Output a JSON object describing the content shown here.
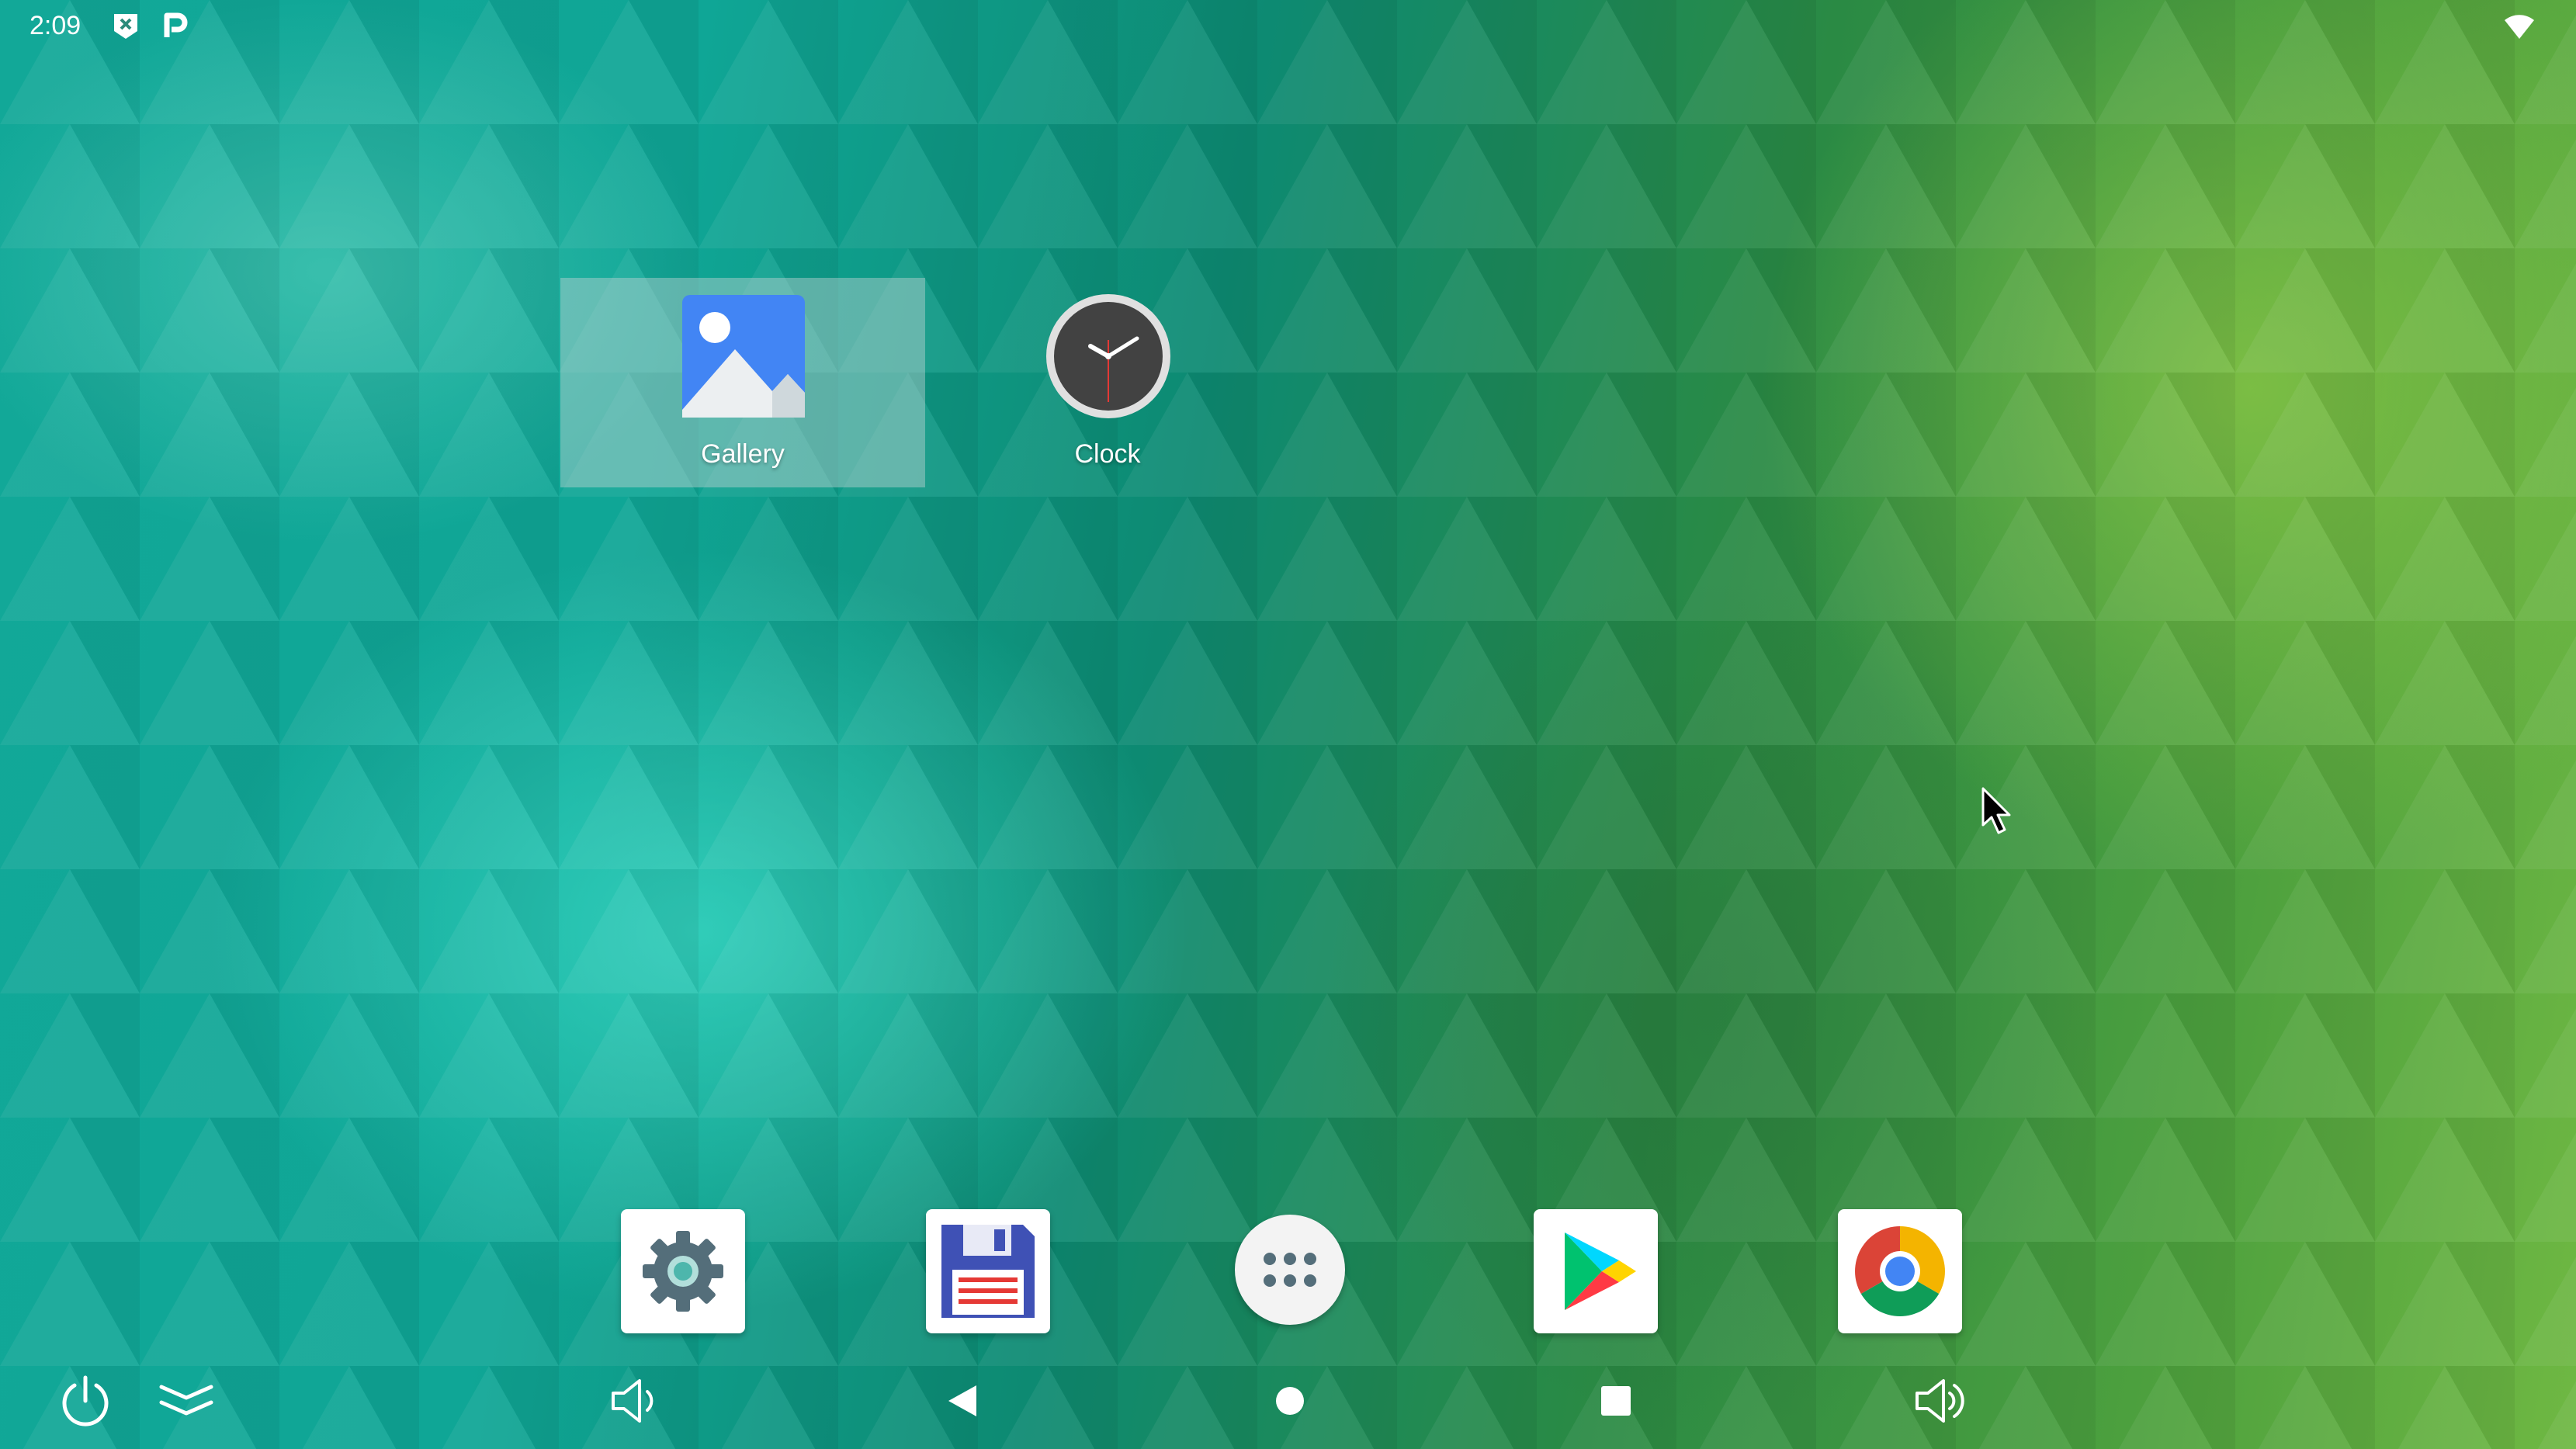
{
  "status_bar": {
    "time": "2:09",
    "left_icons": [
      "notification-x-icon",
      "p-icon"
    ],
    "right_icons": [
      "wifi-icon"
    ]
  },
  "desktop": {
    "items": [
      {
        "label": "Gallery",
        "icon": "gallery-icon",
        "selected": true
      },
      {
        "label": "Clock",
        "icon": "clock-icon",
        "selected": false
      }
    ]
  },
  "dock": {
    "items": [
      {
        "icon": "settings-gear-icon"
      },
      {
        "icon": "floppy-disk-icon"
      },
      {
        "icon": "app-drawer-icon"
      },
      {
        "icon": "play-store-icon"
      },
      {
        "icon": "chrome-icon"
      }
    ]
  },
  "nav_bar": {
    "items": [
      "power-icon",
      "notifications-expand-icon",
      "volume-down-icon",
      "back-icon",
      "home-icon",
      "recents-icon",
      "volume-up-icon"
    ]
  },
  "colors": {
    "wallpaper_teal": "#12a898",
    "wallpaper_green": "#6fb843",
    "gallery_blue": "#4285f4",
    "play_green": "#00c26f",
    "chrome_red": "#db4437",
    "chrome_yellow": "#f4b400",
    "chrome_green": "#0f9d58"
  }
}
